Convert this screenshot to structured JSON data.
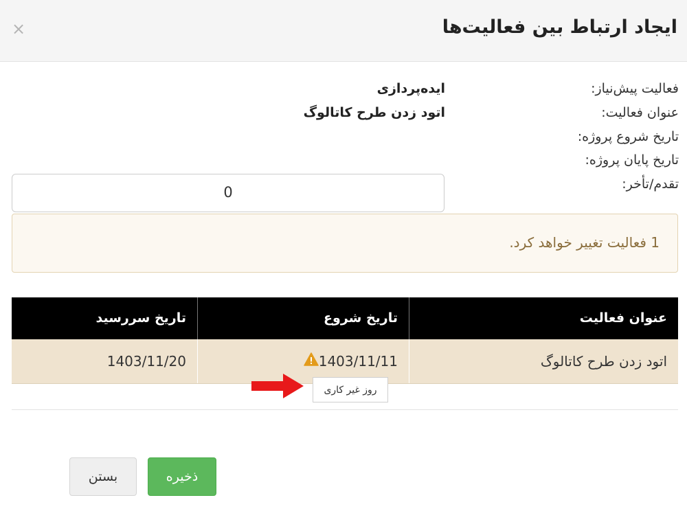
{
  "dialog": {
    "title": "ایجاد ارتباط بین فعالیت‌ها",
    "close_symbol": "×"
  },
  "info": {
    "prerequisite_label": "فعالیت پیش‌نیاز:",
    "prerequisite_value": "ایده‌پردازی",
    "activity_title_label": "عنوان فعالیت:",
    "activity_title_value": "اتود زدن طرح کاتالوگ",
    "project_start_label": "تاریخ شروع پروژه:",
    "project_end_label": "تاریخ پایان پروژه:",
    "lag_label": "تقدم/تأخر:"
  },
  "lag_input": {
    "value": "0"
  },
  "alert": {
    "text": "1 فعالیت تغییر خواهد کرد."
  },
  "table": {
    "headers": [
      "عنوان فعالیت",
      "تاریخ شروع",
      "تاریخ سررسید"
    ],
    "rows": [
      {
        "title": "اتود زدن طرح کاتالوگ",
        "start": "1403/11/11",
        "due": "1403/11/20",
        "start_warning_icon": "warning-triangle-icon"
      }
    ]
  },
  "tooltip": {
    "text": "روز غیر کاری"
  },
  "buttons": {
    "save_label": "ذخیره",
    "close_label": "بستن"
  },
  "colors": {
    "save_button": "#5cb85c",
    "alert_background": "#fcf8f1",
    "alert_text": "#8a6d3b",
    "table_header": "#000000",
    "table_row": "#efe3cf",
    "warning_icon": "#e39b1b",
    "annotation_arrow": "#e8191a"
  }
}
